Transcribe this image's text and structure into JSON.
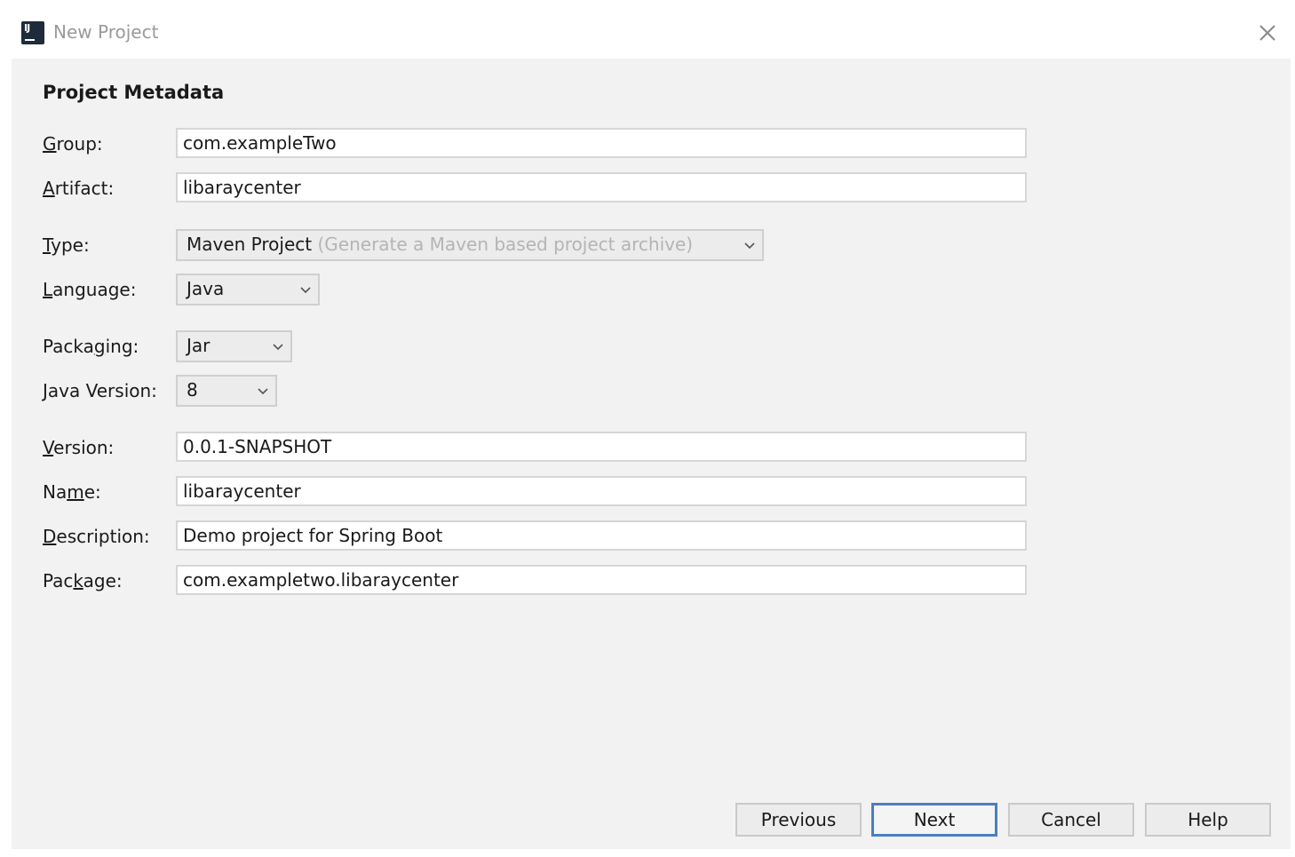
{
  "window": {
    "title": "New Project",
    "app_icon": "intellij-idea-icon",
    "close_icon": "close-icon"
  },
  "section": {
    "title": "Project Metadata"
  },
  "fields": {
    "group": {
      "label_mnemonic": "G",
      "label_rest": "roup:",
      "value": "com.exampleTwo"
    },
    "artifact": {
      "label_mnemonic": "A",
      "label_rest": "rtifact:",
      "value": "libaraycenter"
    },
    "type": {
      "label_mnemonic": "T",
      "label_rest": "ype:",
      "value": "Maven Project",
      "hint": "(Generate a Maven based project archive)"
    },
    "language": {
      "label_mnemonic": "L",
      "label_rest": "anguage:",
      "value": "Java"
    },
    "packaging": {
      "label_pre": "Packa",
      "label_mnemonic": "g",
      "label_rest": "ing:",
      "value": "Jar"
    },
    "java_version": {
      "label_mnemonic": "J",
      "label_rest": "ava Version:",
      "value": "8"
    },
    "version": {
      "label_mnemonic": "V",
      "label_rest": "ersion:",
      "value": "0.0.1-SNAPSHOT"
    },
    "name": {
      "label_pre": "Na",
      "label_mnemonic": "m",
      "label_rest": "e:",
      "value": "libaraycenter"
    },
    "description": {
      "label_mnemonic": "D",
      "label_rest": "escription:",
      "value": "Demo project for Spring Boot"
    },
    "package": {
      "label_pre": "Pac",
      "label_mnemonic": "k",
      "label_rest": "age:",
      "value": "com.exampletwo.libaraycenter"
    }
  },
  "buttons": {
    "previous": "Previous",
    "next": "Next",
    "cancel": "Cancel",
    "help": "Help"
  },
  "colors": {
    "accent_border": "#4a7fc1",
    "panel_bg": "#f2f2f2",
    "hint_text": "#b4b4b4"
  }
}
